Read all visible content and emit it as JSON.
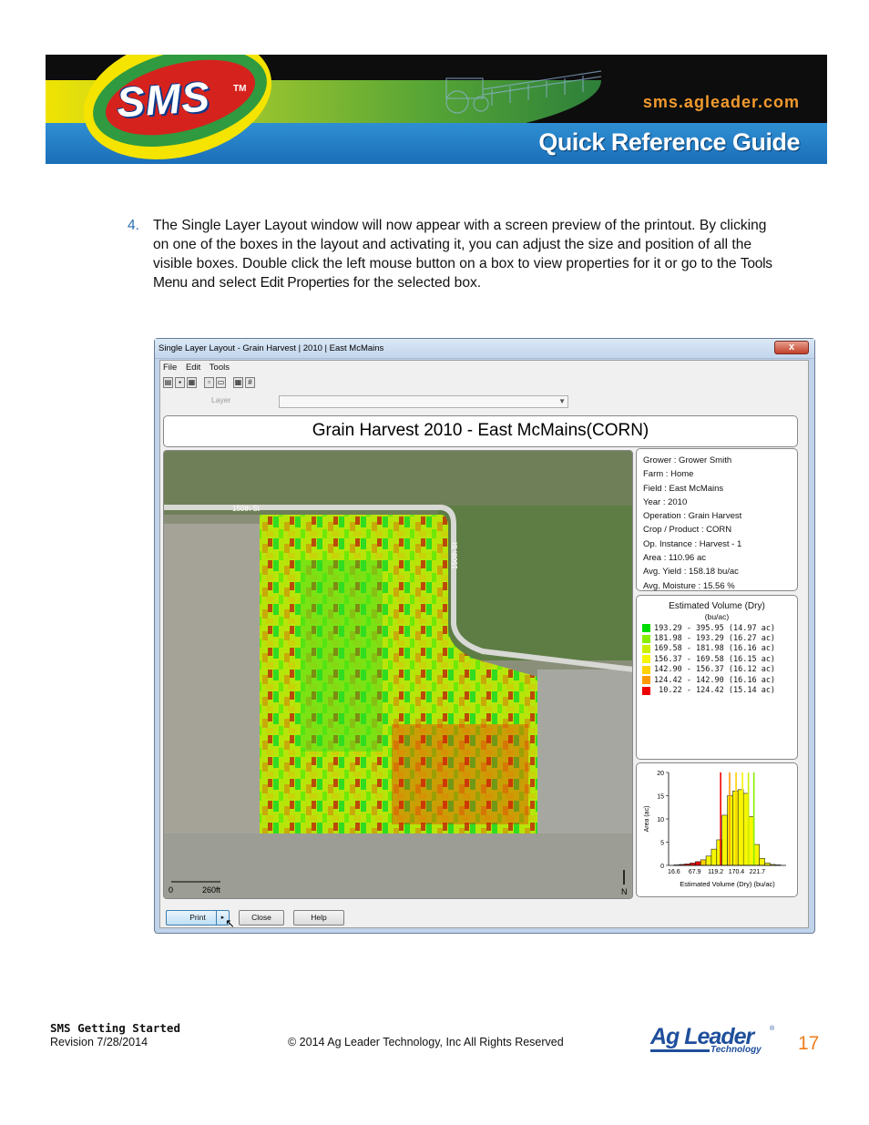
{
  "banner": {
    "logo_text": "SMS",
    "logo_tm": "TM",
    "url": "sms.agleader.com",
    "guide_title": "Quick Reference Guide"
  },
  "step": {
    "number": "4.",
    "text_1": "The Single Layer Layout window will now appear with a screen preview of the printout. By clicking on one of the boxes in the layout and activating it, you can adjust the size and position of all the visible boxes. Double click the left mouse button on a box to view properties for it or go to the ",
    "bold_1": "Tools Menu",
    "text_2": " and select ",
    "bold_2": "Edit Properties",
    "text_3": " for the selected box."
  },
  "window": {
    "title": "Single Layer Layout - Grain Harvest | 2010 | East McMains",
    "close_glyph": "x",
    "menu": [
      "File",
      "Edit",
      "Tools"
    ],
    "layer_label": "Layer",
    "layer_value": "",
    "layout_title": "Grain Harvest 2010 - East McMains(CORN)",
    "info_lines": [
      "Grower : Grower Smith",
      "Farm  : Home",
      "Field  : East McMains",
      "Year : 2010",
      "Operation  : Grain Harvest",
      "Crop / Product : CORN",
      "Op. Instance : Harvest - 1",
      "Area : 110.96 ac",
      "Avg. Yield : 158.18 bu/ac",
      "Avg. Moisture : 15.56 %"
    ],
    "map": {
      "road_label_1": "150th St",
      "road_label_2": "150th St",
      "scale_0": "0",
      "scale_end": "260ft",
      "north": "N"
    },
    "legend": {
      "title": "Estimated Volume (Dry)",
      "unit": "(bu/ac)",
      "rows": [
        {
          "range": "193.29 - 395.95 (14.97 ac)",
          "color": "#00dd00"
        },
        {
          "range": "181.98 - 193.29 (16.27 ac)",
          "color": "#88ee00"
        },
        {
          "range": "169.58 - 181.98 (16.16 ac)",
          "color": "#ccf000"
        },
        {
          "range": "156.37 - 169.58 (16.15 ac)",
          "color": "#f6f600"
        },
        {
          "range": "142.90 - 156.37 (16.12 ac)",
          "color": "#ffd200"
        },
        {
          "range": "124.42 - 142.90 (16.16 ac)",
          "color": "#ff9900"
        },
        {
          "range": " 10.22 - 124.42 (15.14 ac)",
          "color": "#ee0000"
        }
      ]
    },
    "buttons": {
      "print": "Print",
      "print_arrow": "▸",
      "close": "Close",
      "help": "Help"
    }
  },
  "chart_data": {
    "type": "bar",
    "xlabel": "Estimated Volume (Dry) (bu/ac)",
    "ylabel": "Area (ac)",
    "ylim": [
      0,
      20
    ],
    "yticks": [
      "0",
      "5",
      "10",
      "15",
      "20"
    ],
    "xticks": [
      "16.6",
      "67.9",
      "119.2",
      "170.4",
      "221.7"
    ],
    "values": [
      0.1,
      0.2,
      0.3,
      0.5,
      0.8,
      1.2,
      2.0,
      3.5,
      5.5,
      10.8,
      15.0,
      16.0,
      16.3,
      15.5,
      10.5,
      4.5,
      1.5,
      0.5,
      0.2,
      0.1
    ],
    "bar_colors": [
      "#ee0000",
      "#ee0000",
      "#ee0000",
      "#ee0000",
      "#ee0000",
      "#ffd200",
      "#f6f600",
      "#f6f600",
      "#f6f600",
      "#f6f600",
      "#f6f600",
      "#f6f600",
      "#f6f600",
      "#f6f600",
      "#f6f600",
      "#f6f600",
      "#f6f600",
      "#f6f600",
      "#f6f600",
      "#f6f600"
    ],
    "break_lines": [
      124.42,
      142.9,
      156.37,
      169.58,
      181.98,
      193.29
    ],
    "break_colors": [
      "#ee0000",
      "#ff9900",
      "#ffd200",
      "#f6f600",
      "#ccf000",
      "#88ee00"
    ],
    "xmin": 16.6,
    "xmax": 260
  },
  "footer": {
    "doc_title": "SMS Getting Started",
    "revision": "Revision 7/28/2014",
    "copyright": "© 2014 Ag Leader Technology, Inc All Rights Reserved",
    "logo_main": "Ag Leader",
    "logo_sub": "Technology",
    "logo_reg": "®",
    "page_number": "17"
  }
}
